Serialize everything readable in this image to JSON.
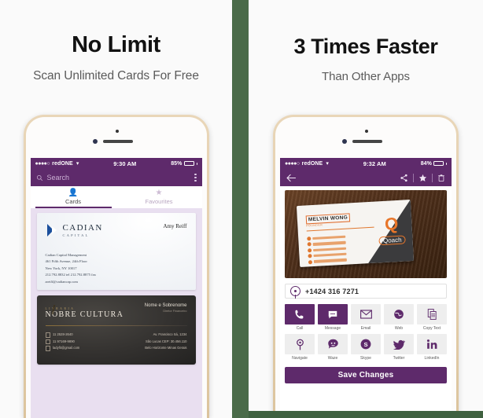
{
  "colors": {
    "divider_green": "#4a6b49",
    "app_purple": "#5e2a6b",
    "accent_orange": "#e0772f",
    "card_bg_lavender": "#e9dff0"
  },
  "left_panel": {
    "headline": "No Limit",
    "subhead": "Scan Unlimited Cards For Free",
    "status_bar": {
      "signal_dots": "●●●●○",
      "carrier": "redONE",
      "wifi_icon": "wifi-icon",
      "time": "9:30 AM",
      "battery_percent": "85%"
    },
    "navbar": {
      "search_icon": "search-icon",
      "search_placeholder": "Search",
      "overflow_icon": "kebab-menu-icon"
    },
    "tabs": [
      {
        "label": "Cards",
        "icon": "person-icon",
        "active": true
      },
      {
        "label": "Favourites",
        "icon": "star-icon",
        "active": false
      }
    ],
    "cards": [
      {
        "company": "CADIAN",
        "company_sub": "CAPITAL",
        "person": "Amy Reiff",
        "details": [
          "Cadian Capital Management",
          "461 Fifth Avenue, 24th Floor",
          "New York, NY 10017",
          "212.792.8832   tel   212.792.8875 fax",
          "areiff@cadiancap.com"
        ]
      },
      {
        "pre_title": "LIVRARIA",
        "company": "NOBRE CULTURA",
        "person": "Nome e Sobrenome",
        "role": "Diretor Financeiro",
        "contacts": [
          "11 2528-2640",
          "11 97169-9890",
          "ladyfit@gmail.com"
        ],
        "address": [
          "Av. Francisco Sá, 1234",
          "São Lucas    CEP: 30.456.110",
          "Belo Horizonte   Minas Gerais"
        ]
      }
    ]
  },
  "right_panel": {
    "headline": "3 Times Faster",
    "subhead": "Than Other Apps",
    "status_bar": {
      "signal_dots": "●●●●○",
      "carrier": "redONE",
      "wifi_icon": "wifi-icon",
      "time": "9:32 AM",
      "battery_percent": "84%"
    },
    "navbar": {
      "back_icon": "back-arrow-icon",
      "share_icon": "share-icon",
      "favourite_icon": "star-icon",
      "delete_icon": "trash-icon"
    },
    "photo_card": {
      "name": "MELVIN WONG",
      "role": "FOUNDER",
      "logo_letter": "Q",
      "logo_word": "Qoach"
    },
    "phone_field": {
      "icon": "location-pin-icon",
      "value": "+1424 316 7271"
    },
    "actions": [
      {
        "label": "Call",
        "icon": "phone-icon",
        "style": "filled"
      },
      {
        "label": "Message",
        "icon": "chat-icon",
        "style": "filled"
      },
      {
        "label": "Email",
        "icon": "envelope-icon",
        "style": "plain"
      },
      {
        "label": "Web",
        "icon": "globe-icon",
        "style": "plain"
      },
      {
        "label": "Copy Text",
        "icon": "copy-icon",
        "style": "plain"
      },
      {
        "label": "Navigate",
        "icon": "map-pin-icon",
        "style": "plain"
      },
      {
        "label": "Waze",
        "icon": "waze-icon",
        "style": "plain"
      },
      {
        "label": "Skype",
        "icon": "skype-icon",
        "style": "plain"
      },
      {
        "label": "Twitter",
        "icon": "twitter-icon",
        "style": "plain"
      },
      {
        "label": "LinkedIn",
        "icon": "linkedin-icon",
        "style": "plain"
      }
    ],
    "save_button": "Save Changes"
  }
}
